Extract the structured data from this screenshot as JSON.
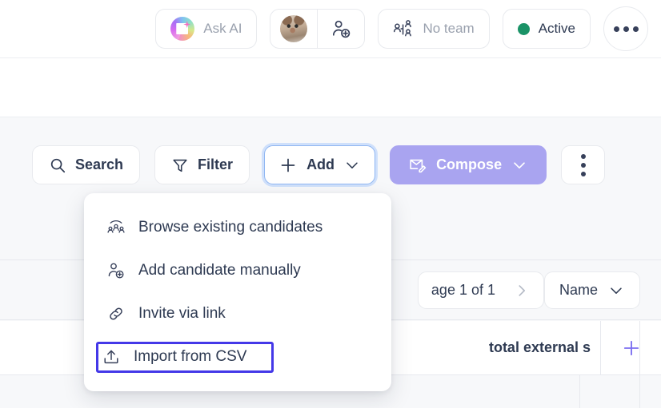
{
  "topbar": {
    "ask_ai": {
      "label": "Ask AI",
      "icon": "ai-sparkle-icon"
    },
    "avatar": {
      "icon": "user-avatar",
      "alt": "cat-avatar"
    },
    "add_person": {
      "icon": "add-person-icon"
    },
    "team": {
      "label": "No team",
      "icon": "team-icon"
    },
    "status": {
      "label": "Active",
      "color": "#1a9367"
    },
    "more": {
      "icon": "more-horizontal-icon"
    }
  },
  "toolbar": {
    "search": {
      "label": "Search",
      "icon": "search-icon"
    },
    "filter": {
      "label": "Filter",
      "icon": "filter-icon"
    },
    "add": {
      "label": "Add",
      "icon": "plus-icon",
      "caret": "chevron-down-icon",
      "focused": true
    },
    "compose": {
      "label": "Compose",
      "icon": "compose-mail-icon",
      "caret": "chevron-down-icon",
      "color": "#a9a4f0"
    },
    "overflow": {
      "icon": "more-vertical-icon"
    }
  },
  "menu": {
    "items": [
      {
        "label": "Browse existing candidates",
        "icon": "people-group-icon",
        "highlighted": false
      },
      {
        "label": "Add candidate manually",
        "icon": "add-person-icon",
        "highlighted": false
      },
      {
        "label": "Invite via link",
        "icon": "link-icon",
        "highlighted": false
      },
      {
        "label": "Import from CSV",
        "icon": "upload-icon",
        "highlighted": true
      }
    ],
    "highlight_color": "#4438e8"
  },
  "pagination": {
    "label": "age 1 of 1",
    "next_icon": "chevron-right-icon"
  },
  "sort": {
    "label": "Name",
    "caret": "chevron-down-icon"
  },
  "table": {
    "header_cell": "total external s",
    "add_column_icon": "plus-icon",
    "add_column_color": "#7c6ef0"
  }
}
